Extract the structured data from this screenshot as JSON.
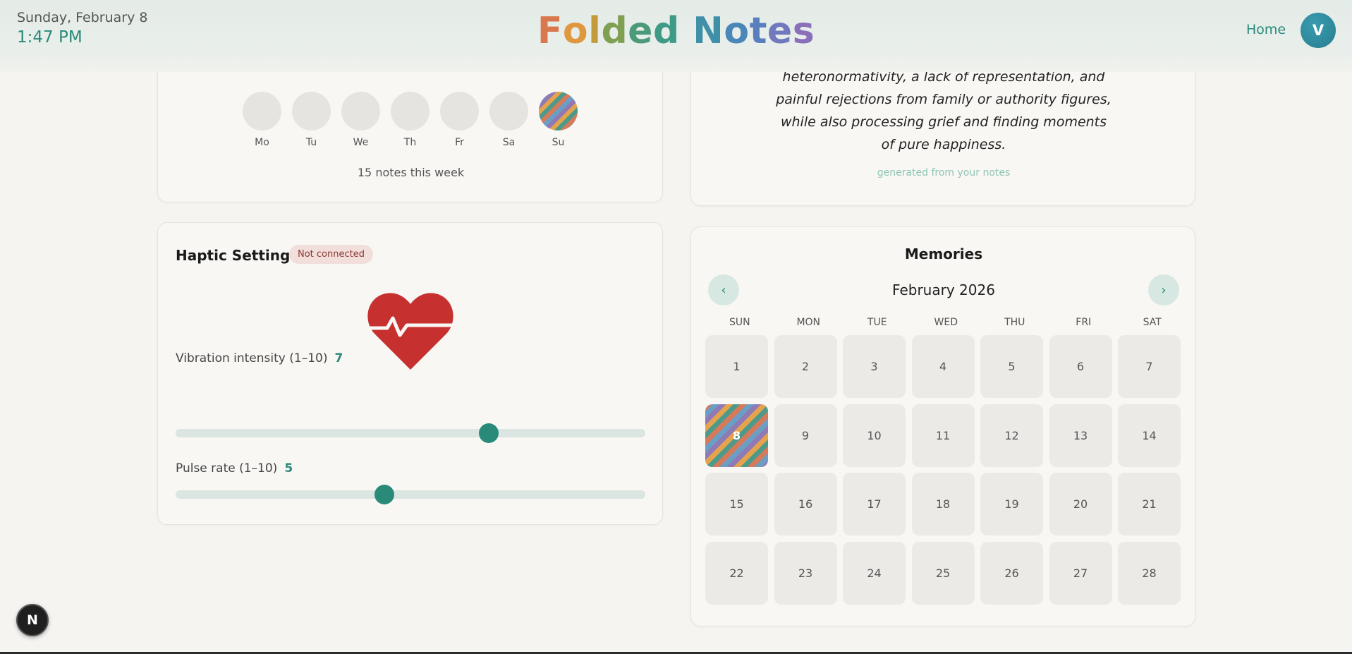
{
  "header": {
    "date": "Sunday, February 8",
    "time": "1:47 PM",
    "logo_letters": [
      {
        "ch": "F",
        "color": "#d9774f"
      },
      {
        "ch": "o",
        "color": "#e0983f"
      },
      {
        "ch": "l",
        "color": "#c39a3c"
      },
      {
        "ch": "d",
        "color": "#7f9f52"
      },
      {
        "ch": "e",
        "color": "#4c9a7a"
      },
      {
        "ch": "d",
        "color": "#3f9a86"
      },
      {
        "ch": " ",
        "color": "#000000"
      },
      {
        "ch": "N",
        "color": "#3f8fa8"
      },
      {
        "ch": "o",
        "color": "#4a86b8"
      },
      {
        "ch": "t",
        "color": "#5a7fbf"
      },
      {
        "ch": "e",
        "color": "#7079bd"
      },
      {
        "ch": "s",
        "color": "#8a6fba"
      }
    ],
    "home_label": "Home",
    "avatar_initial": "V"
  },
  "week": {
    "days": [
      {
        "label": "Mo",
        "active": false
      },
      {
        "label": "Tu",
        "active": false
      },
      {
        "label": "We",
        "active": false
      },
      {
        "label": "Th",
        "active": false
      },
      {
        "label": "Fr",
        "active": false
      },
      {
        "label": "Sa",
        "active": false
      },
      {
        "label": "Su",
        "active": true
      }
    ],
    "count_text": "15 notes this week"
  },
  "summary": {
    "lines": [
      "heteronormativity, a lack of representation, and",
      "painful rejections from family or authority figures,",
      "while also processing grief and finding moments",
      "of pure happiness."
    ],
    "generated_label": "generated from your notes"
  },
  "haptic": {
    "title": "Haptic Settings",
    "status": "Not connected",
    "heart_icon": "heartbeat-icon",
    "vibration": {
      "label": "Vibration intensity (1–10)",
      "value": 7,
      "min": 1,
      "max": 10
    },
    "pulse": {
      "label": "Pulse rate (1–10)",
      "value": 5,
      "min": 1,
      "max": 10
    }
  },
  "memories": {
    "title": "Memories",
    "month": "February 2026",
    "prev_icon": "‹",
    "next_icon": "›",
    "weekdays": [
      "SUN",
      "MON",
      "TUE",
      "WED",
      "THU",
      "FRI",
      "SAT"
    ],
    "days": [
      "1",
      "2",
      "3",
      "4",
      "5",
      "6",
      "7",
      "8",
      "9",
      "10",
      "11",
      "12",
      "13",
      "14",
      "15",
      "16",
      "17",
      "18",
      "19",
      "20",
      "21",
      "22",
      "23",
      "24",
      "25",
      "26",
      "27",
      "28"
    ],
    "highlighted_day": "8"
  },
  "dev_badge": "N"
}
